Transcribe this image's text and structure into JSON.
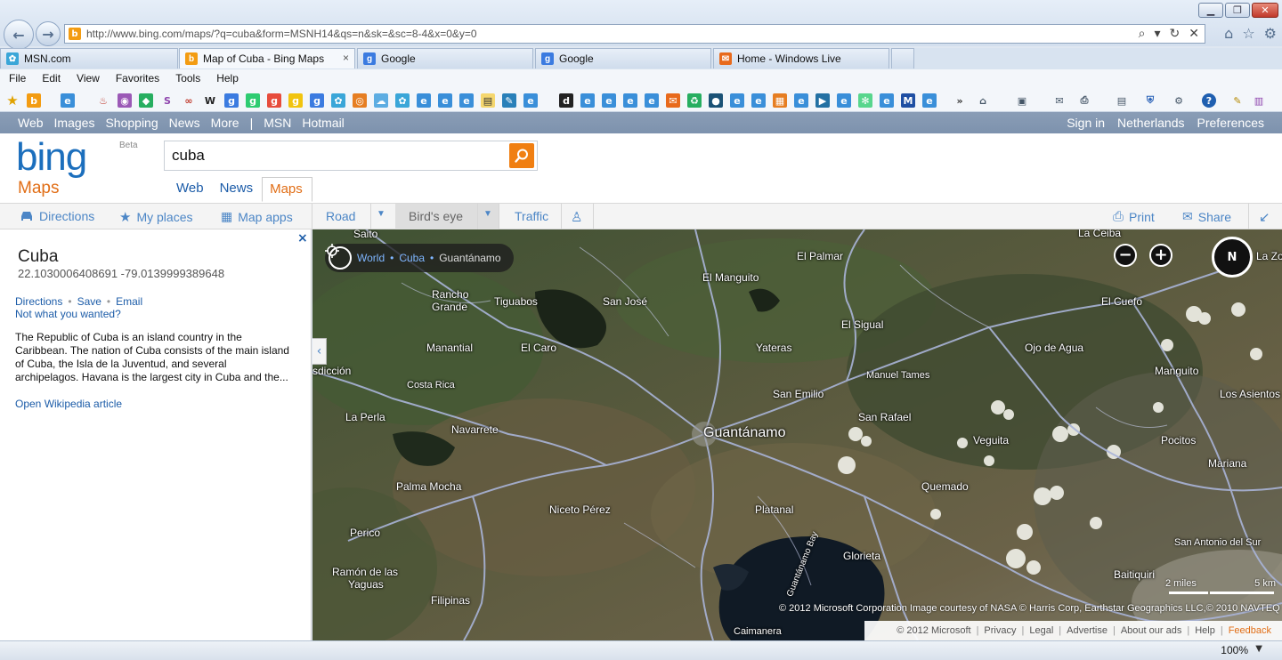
{
  "browser": {
    "url": "http://www.bing.com/maps/?q=cuba&form=MSNH14&qs=n&sk=&sc=8-4&x=0&y=0",
    "tabs": [
      {
        "label": "MSN.com",
        "icon": "msn-icon"
      },
      {
        "label": "Map of Cuba - Bing Maps",
        "icon": "bing-icon"
      },
      {
        "label": "Google",
        "icon": "google-icon"
      },
      {
        "label": "Google",
        "icon": "google-icon"
      },
      {
        "label": "Home - Windows Live",
        "icon": "windows-live-icon"
      }
    ],
    "tab_close": "×",
    "menu": [
      "File",
      "Edit",
      "View",
      "Favorites",
      "Tools",
      "Help"
    ],
    "zoom": "100%"
  },
  "bing": {
    "topnav": {
      "web": "Web",
      "images": "Images",
      "shopping": "Shopping",
      "news": "News",
      "more": "More",
      "sep": "|",
      "msn": "MSN",
      "hotmail": "Hotmail"
    },
    "topright": {
      "signin": "Sign in",
      "region": "Netherlands",
      "preferences": "Preferences"
    },
    "logo": "bing",
    "beta": "Beta",
    "maps_title": "Maps",
    "search_value": "cuba",
    "scopes": {
      "web": "Web",
      "news": "News",
      "maps": "Maps"
    },
    "accent": "#e16e16",
    "link_color": "#1c5ca8"
  },
  "toolbar": {
    "directions": "Directions",
    "my_places": "My places",
    "map_apps": "Map apps",
    "road": "Road",
    "birds_eye": "Bird's eye",
    "traffic": "Traffic",
    "print": "Print",
    "share": "Share"
  },
  "panel": {
    "close": "×",
    "title": "Cuba",
    "coords": "22.1030006408691 -79.0139999389648",
    "actions": {
      "directions": "Directions",
      "save": "Save",
      "email": "Email",
      "dot": "•"
    },
    "not_wanted": "Not what you wanted?",
    "description": "The Republic of Cuba is an island country in the Caribbean. The nation of Cuba consists of the main island of Cuba, the Isla de la Juventud, and several archipelagos. Havana is the largest city in Cuba and the...",
    "wiki": "Open Wikipedia article"
  },
  "map": {
    "breadcrumb": {
      "world": "World",
      "cuba": "Cuba",
      "current": "Guantánamo",
      "sep": "•"
    },
    "compass": "N",
    "places": {
      "saito": "Saito",
      "la_ceiba": "La Ceiba",
      "la_zo": "La Zo",
      "el_palmar": "El Palmar",
      "el_manguito": "El Manguito",
      "rancho_grande_1": "Rancho",
      "rancho_grande_2": "Grande",
      "tiguabos": "Tiguabos",
      "san_jose": "San José",
      "el_cuefo": "El Cuefo",
      "el_sigual": "El Sigual",
      "manantial": "Manantial",
      "el_caro": "El Caro",
      "yateras": "Yateras",
      "ojo_de_agua": "Ojo de Agua",
      "jurisdiccion": "sdicción",
      "manguito": "Manguito",
      "manuel_tames": "Manuel Tames",
      "costa_rica": "Costa Rica",
      "san_emilio": "San Emilio",
      "los_asientos": "Los Asientos",
      "la_perla": "La Perla",
      "san_rafael": "San Rafael",
      "navarrete": "Navarrete",
      "guantanamo": "Guantánamo",
      "veguita": "Veguita",
      "pocitos": "Pocitos",
      "mariana": "Mariana",
      "palma_mocha": "Palma Mocha",
      "quemado": "Quemado",
      "niceto_perez": "Niceto Pérez",
      "platanal": "Platanal",
      "perico": "Perico",
      "san_antonio_del_sur": "San Antonio del Sur",
      "glorieta": "Glorieta",
      "ramon_1": "Ramón de las",
      "ramon_2": "Yaguas",
      "guantanamo_bay": "Guantánamo Bay",
      "filipinas": "Filipinas",
      "baitiquiri": "Baitiquiri",
      "caimanera": "Caimanera"
    },
    "scale": {
      "miles": "2 miles",
      "km": "5 km"
    },
    "copyright": "© 2012 Microsoft Corporation   Image courtesy of NASA © Harris Corp, Earthstar Geographics LLC,© 2010 NAVTEQ",
    "footer": {
      "ms": "© 2012 Microsoft",
      "privacy": "Privacy",
      "legal": "Legal",
      "advertise": "Advertise",
      "about_ads": "About our ads",
      "help": "Help",
      "feedback": "Feedback",
      "sep": "|"
    }
  }
}
